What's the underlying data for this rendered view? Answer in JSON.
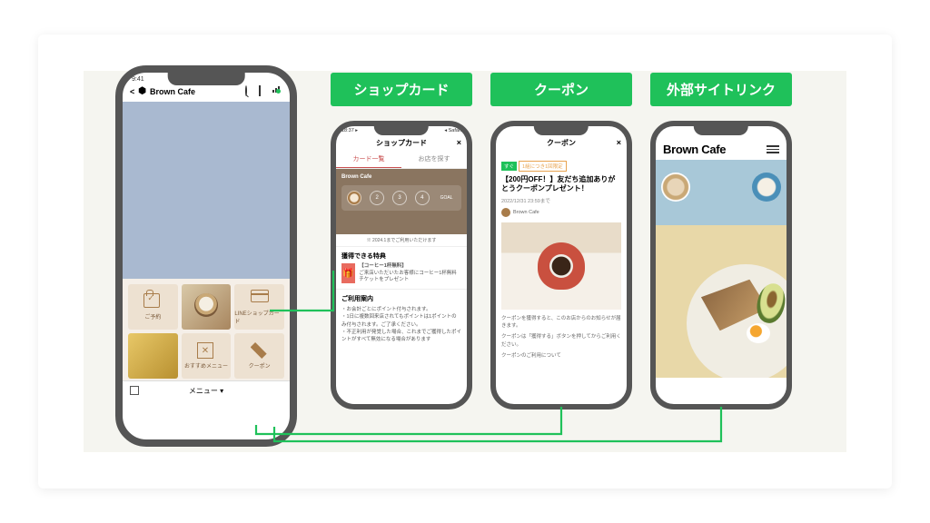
{
  "badges": {
    "shopcard": "ショップカード",
    "coupon": "クーポン",
    "external": "外部サイトリンク"
  },
  "main": {
    "time": "9:41",
    "title": "Brown Cafe",
    "back": "<",
    "tiles": {
      "reserve": "ご予約",
      "latte": "",
      "card": "LINEショップカード",
      "gold": "",
      "recommend": "おすすめメニュー",
      "coupon": "クーポン"
    },
    "menubar": "メニュー ▾"
  },
  "shopcard": {
    "status_l": "18:37 ▸",
    "status_r": "◂ Safari",
    "title": "ショップカード",
    "close": "×",
    "tab1": "カード一覧",
    "tab2": "お店を探す",
    "brand": "Brown Cafe",
    "stamps": [
      "",
      "2",
      "3",
      "4"
    ],
    "goal": "GOAL",
    "expiry": "※ 2024.1までご利用いただけます",
    "sec1": "獲得できる特典",
    "reward_t": "【コーヒー1杯無料】",
    "reward_d": "ご来店いただいたお客様にコーヒー1杯無料チケットをプレゼント",
    "sec2": "ご利用案内",
    "rule1": "・お会計ごとにポイント付与されます。",
    "rule2": "・1日に複数回来店されてもポイントは1ポイントのみ付与されます。ご了承ください。",
    "rule3": "・不正利用が発覚した場合、これまでご獲得したポイントがすべて無効になる場合があります"
  },
  "coupon": {
    "title": "クーポン",
    "close": "×",
    "tag1": "すぐ",
    "tag2": "1組につき1回限定",
    "head": "【200円OFF！】友だち追加ありがとうクーポンプレゼント！",
    "date": "2022/12/31 23:59まで",
    "shop": "Brown Cafe",
    "d1": "クーポンを獲得すると、このお店からのお知らせが届きます。",
    "d2": "クーポンは「獲得する」ボタンを押してからご利用ください。",
    "d3": "クーポンのご利用について"
  },
  "ext": {
    "brand": "Brown Cafe"
  }
}
